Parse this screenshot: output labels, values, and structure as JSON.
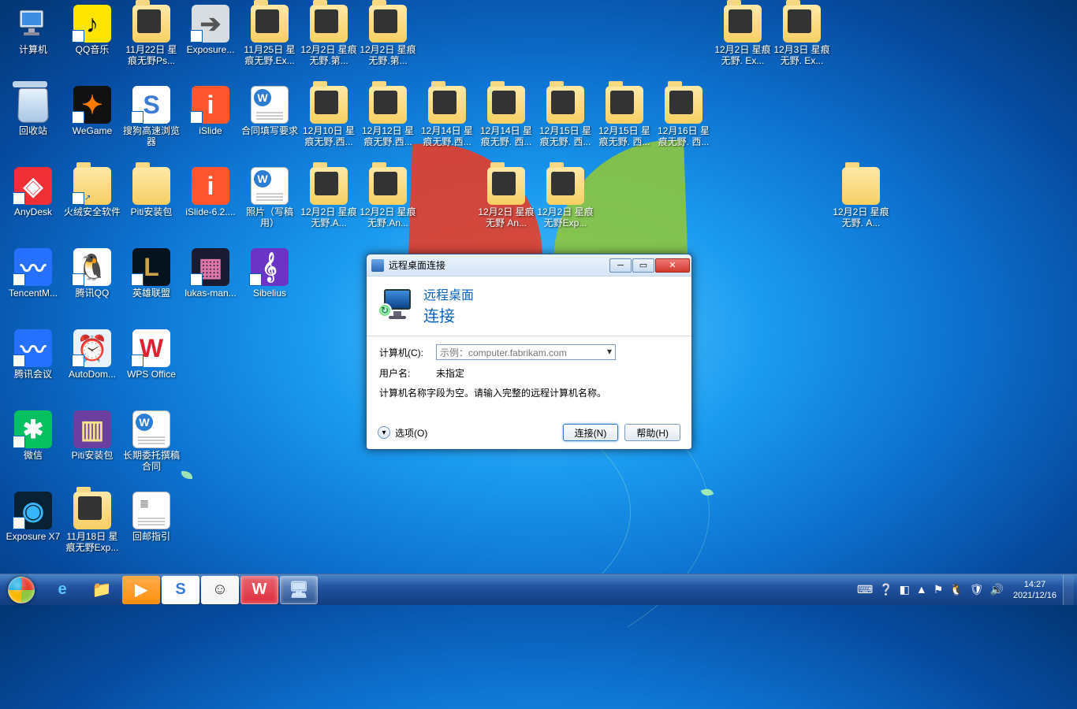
{
  "desktop": {
    "icons": [
      {
        "col": 0,
        "row": 0,
        "type": "computer",
        "label": "计算机"
      },
      {
        "col": 1,
        "row": 0,
        "type": "app",
        "bg": "#ffe500",
        "fg": "#111",
        "char": "♪",
        "label": "QQ音乐",
        "shortcut": true
      },
      {
        "col": 2,
        "row": 0,
        "type": "folder-dark",
        "label": "11月22日 星痕无野Ps..."
      },
      {
        "col": 3,
        "row": 0,
        "type": "app",
        "bg": "#d8dde2",
        "fg": "#555",
        "char": "➔",
        "label": "Exposure...",
        "shortcut": true
      },
      {
        "col": 4,
        "row": 0,
        "type": "folder-dark",
        "label": "11月25日 星痕无野.Ex..."
      },
      {
        "col": 5,
        "row": 0,
        "type": "folder-dark",
        "label": "12月2日 星痕无野.第..."
      },
      {
        "col": 6,
        "row": 0,
        "type": "folder-dark",
        "label": "12月2日 星痕无野.第..."
      },
      {
        "col": 12,
        "row": 0,
        "type": "folder-dark",
        "label": "12月2日 星痕无野. Ex..."
      },
      {
        "col": 13,
        "row": 0,
        "type": "folder-dark",
        "label": "12月3日 星痕无野. Ex..."
      },
      {
        "col": 0,
        "row": 1,
        "type": "recycle",
        "label": "回收站"
      },
      {
        "col": 1,
        "row": 1,
        "type": "app",
        "bg": "#111",
        "fg": "#ff7a00",
        "char": "✦",
        "label": "WeGame",
        "shortcut": true
      },
      {
        "col": 2,
        "row": 1,
        "type": "app",
        "bg": "#fff",
        "fg": "#3b7bd6",
        "char": "S",
        "label": "搜狗高速浏览器",
        "shortcut": true
      },
      {
        "col": 3,
        "row": 1,
        "type": "app",
        "bg": "#ff5630",
        "fg": "#fff",
        "char": "i",
        "label": "iSlide",
        "shortcut": true
      },
      {
        "col": 4,
        "row": 1,
        "type": "doc",
        "bg": "#2b7cd3",
        "fg": "#fff",
        "char": "W",
        "label": "合同填写要求"
      },
      {
        "col": 5,
        "row": 1,
        "type": "folder-dark",
        "label": "12月10日 星痕无野.西..."
      },
      {
        "col": 6,
        "row": 1,
        "type": "folder-dark",
        "label": "12月12日 星痕无野.西..."
      },
      {
        "col": 7,
        "row": 1,
        "type": "folder-dark",
        "label": "12月14日 星痕无野.西..."
      },
      {
        "col": 8,
        "row": 1,
        "type": "folder-dark",
        "label": "12月14日 星痕无野. 西..."
      },
      {
        "col": 9,
        "row": 1,
        "type": "folder-dark",
        "label": "12月15日 星痕无野. 西..."
      },
      {
        "col": 10,
        "row": 1,
        "type": "folder-dark",
        "label": "12月15日 星痕无野. 西..."
      },
      {
        "col": 11,
        "row": 1,
        "type": "folder-dark",
        "label": "12月16日 星痕无野. 西..."
      },
      {
        "col": 0,
        "row": 2,
        "type": "app",
        "bg": "#ef2f35",
        "fg": "#fff",
        "char": "◈",
        "label": "AnyDesk",
        "shortcut": true
      },
      {
        "col": 1,
        "row": 2,
        "type": "folder",
        "label": "火绒安全软件",
        "shortcut": true
      },
      {
        "col": 2,
        "row": 2,
        "type": "folder",
        "label": "Piti安装包"
      },
      {
        "col": 3,
        "row": 2,
        "type": "app",
        "bg": "#ff5630",
        "fg": "#fff",
        "char": "i",
        "label": "iSlide-6.2...."
      },
      {
        "col": 4,
        "row": 2,
        "type": "doc",
        "bg": "#2b7cd3",
        "fg": "#fff",
        "char": "W",
        "label": "照片（写稿用）"
      },
      {
        "col": 5,
        "row": 2,
        "type": "folder-dark",
        "label": "12月2日 星痕无野.A..."
      },
      {
        "col": 6,
        "row": 2,
        "type": "folder-dark",
        "label": "12月2日 星痕无野.An..."
      },
      {
        "col": 8,
        "row": 2,
        "type": "folder-dark",
        "label": "12月2日 星痕无野 An..."
      },
      {
        "col": 9,
        "row": 2,
        "type": "folder-dark",
        "label": "12月2日 星痕无野Exp..."
      },
      {
        "col": 14,
        "row": 2,
        "type": "folder",
        "label": "12月2日 星痕无野. A..."
      },
      {
        "col": 0,
        "row": 3,
        "type": "app",
        "bg": "#2670ff",
        "fg": "#fff",
        "char": "〰",
        "label": "TencentM...",
        "shortcut": true
      },
      {
        "col": 1,
        "row": 3,
        "type": "app",
        "bg": "#fff",
        "fg": "#000",
        "char": "🐧",
        "label": "腾讯QQ",
        "shortcut": true
      },
      {
        "col": 2,
        "row": 3,
        "type": "app",
        "bg": "#07121f",
        "fg": "#c9a24a",
        "char": "L",
        "label": "英雄联盟",
        "shortcut": true
      },
      {
        "col": 3,
        "row": 3,
        "type": "app",
        "bg": "#1a1a30",
        "fg": "#d7a",
        "char": "▦",
        "label": "lukas-man...",
        "shortcut": true
      },
      {
        "col": 4,
        "row": 3,
        "type": "app",
        "bg": "#6a35c7",
        "fg": "#fff",
        "char": "𝄞",
        "label": "Sibelius",
        "shortcut": true
      },
      {
        "col": 0,
        "row": 4,
        "type": "app",
        "bg": "#2670ff",
        "fg": "#fff",
        "char": "〰",
        "label": "腾讯会议",
        "shortcut": true
      },
      {
        "col": 1,
        "row": 4,
        "type": "app",
        "bg": "#e9f2fb",
        "fg": "#3a76c2",
        "char": "⏰",
        "label": "AutoDom...",
        "shortcut": true
      },
      {
        "col": 2,
        "row": 4,
        "type": "app",
        "bg": "#fff",
        "fg": "#d23",
        "char": "W",
        "label": "WPS Office",
        "shortcut": true
      },
      {
        "col": 0,
        "row": 5,
        "type": "app",
        "bg": "#07c160",
        "fg": "#fff",
        "char": "✱",
        "label": "微信",
        "shortcut": true
      },
      {
        "col": 1,
        "row": 5,
        "type": "app",
        "bg": "#6b3fa0",
        "fg": "#f6df8d",
        "char": "▥",
        "label": "Piti安装包"
      },
      {
        "col": 2,
        "row": 5,
        "type": "doc",
        "bg": "#2b7cd3",
        "fg": "#fff",
        "char": "W",
        "label": "长期委托撰稿合同"
      },
      {
        "col": 0,
        "row": 6,
        "type": "app",
        "bg": "#0a2033",
        "fg": "#37b6ff",
        "char": "◉",
        "label": "Exposure X7",
        "shortcut": true
      },
      {
        "col": 1,
        "row": 6,
        "type": "folder-dark",
        "label": "11月18日 星痕无野Exp..."
      },
      {
        "col": 2,
        "row": 6,
        "type": "doc",
        "bg": "#fff",
        "fg": "#888",
        "char": "≣",
        "label": "回邮指引"
      }
    ]
  },
  "rdp": {
    "title": "远程桌面连接",
    "banner_l1": "远程桌面",
    "banner_l2": "连接",
    "computer_label": "计算机(C):",
    "computer_placeholder": "示例：computer.fabrikam.com",
    "user_label": "用户名:",
    "user_value": "未指定",
    "message": "计算机名称字段为空。请输入完整的远程计算机名称。",
    "options": "选项(O)",
    "connect": "连接(N)",
    "help": "帮助(H)"
  },
  "taskbar": {
    "items": [
      {
        "name": "ie",
        "char": "e",
        "bg": "",
        "fg": "#59c3ff"
      },
      {
        "name": "explorer",
        "char": "📁",
        "bg": "",
        "fg": "#ffe9a8"
      },
      {
        "name": "media",
        "char": "▶",
        "bg": "#ff8a00",
        "fg": "#fff"
      },
      {
        "name": "sogou",
        "char": "S",
        "bg": "#fff",
        "fg": "#3b7bd6",
        "active": true
      },
      {
        "name": "avatar",
        "char": "☺",
        "bg": "#f5f5f5",
        "fg": "#333",
        "active": true
      },
      {
        "name": "wps",
        "char": "W",
        "bg": "#d23",
        "fg": "#fff",
        "active": true
      },
      {
        "name": "rdp",
        "char": "🖥",
        "bg": "",
        "fg": "#cfe3f8",
        "active": true
      }
    ],
    "tray": [
      "⌨",
      "❔",
      "◧",
      "▲",
      "⚑",
      "🐧",
      "🛡",
      "🔊"
    ],
    "time": "14:27",
    "date": "2021/12/16"
  }
}
